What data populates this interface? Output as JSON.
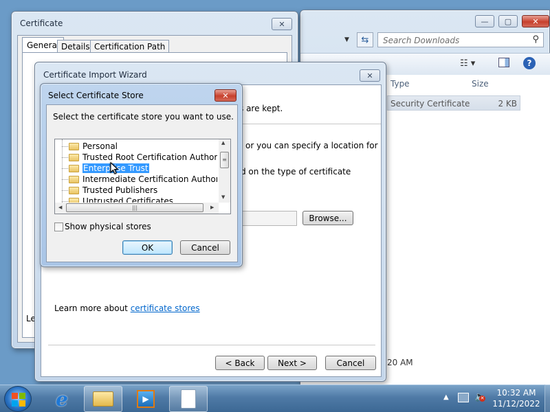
{
  "explorer": {
    "search_placeholder": "Search Downloads",
    "columns": {
      "type": "Type",
      "size": "Size"
    },
    "row": {
      "type": "Security Certificate",
      "size": "2 KB"
    },
    "time_fragment": "20 AM"
  },
  "certificate_window": {
    "title": "Certificate",
    "tabs": [
      "General",
      "Details",
      "Certification Path"
    ],
    "left_fragment": "Le"
  },
  "wizard": {
    "title": "Certificate Import Wizard",
    "text1": "s are kept.",
    "text2": "or you can specify a location for",
    "text3": "d on the type of certificate",
    "browse_button": "Browse...",
    "learn_more": "Learn more about ",
    "learn_more_link": "certificate stores",
    "back_button": "< Back",
    "next_button": "Next >",
    "cancel_button": "Cancel"
  },
  "store_dialog": {
    "title": "Select Certificate Store",
    "instruction": "Select the certificate store you want to use.",
    "stores": [
      "Personal",
      "Trusted Root Certification Authorities",
      "Enterprise Trust",
      "Intermediate Certification Authorities",
      "Trusted Publishers",
      "Untrusted Certificates"
    ],
    "selected_store": "Enterprise Trust",
    "show_physical": "Show physical stores",
    "show_physical_checked": false,
    "ok_button": "OK",
    "cancel_button": "Cancel"
  },
  "taskbar": {
    "time": "10:32 AM",
    "date": "11/12/2022"
  },
  "colors": {
    "selection": "#3399ff",
    "link": "#0066cc",
    "close_red": "#c7402c"
  }
}
